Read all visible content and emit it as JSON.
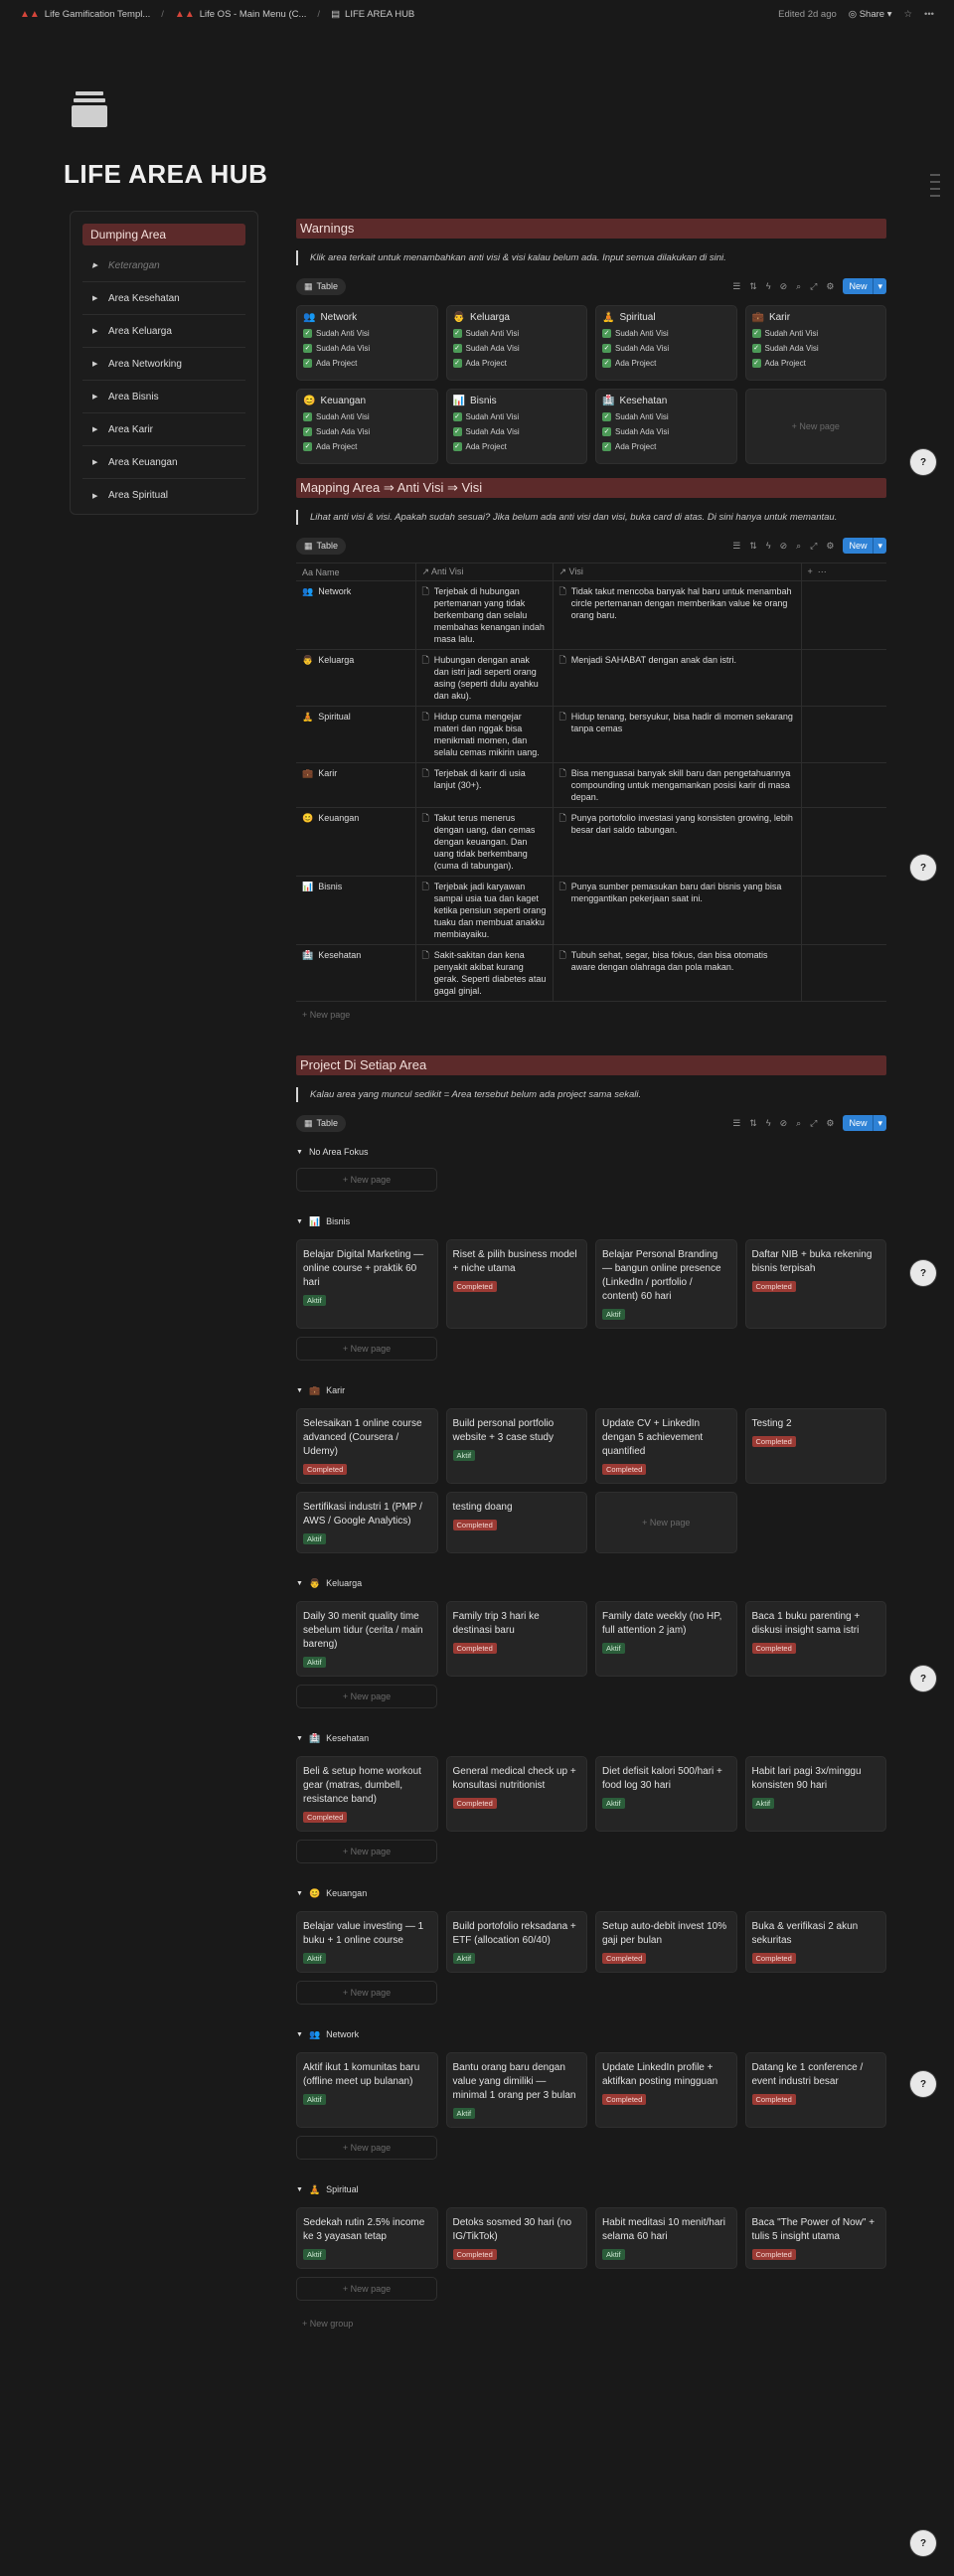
{
  "topbar": {
    "crumbs": [
      "Life Gamification Templ...",
      "Life OS - Main Menu (C...",
      "LIFE AREA HUB"
    ],
    "edited": "Edited 2d ago",
    "share": "Share"
  },
  "page": {
    "title": "LIFE AREA HUB"
  },
  "sidebar": {
    "title": "Dumping Area",
    "items": [
      "Keterangan",
      "Area Kesehatan",
      "Area Keluarga",
      "Area Networking",
      "Area Bisnis",
      "Area Karir",
      "Area Keuangan",
      "Area Spiritual"
    ]
  },
  "warnings": {
    "heading": "Warnings",
    "note": "Klik area terkait untuk menambahkan anti visi & visi kalau belum ada. Input semua dilakukan di sini.",
    "view": "Table",
    "new": "New",
    "cards": [
      {
        "icon": "👥",
        "title": "Network",
        "c1": "Sudah Anti Visi",
        "c2": "Sudah Ada Visi",
        "c3": "Ada Project"
      },
      {
        "icon": "👨",
        "title": "Keluarga",
        "c1": "Sudah Anti Visi",
        "c2": "Sudah Ada Visi",
        "c3": "Ada Project"
      },
      {
        "icon": "🧘",
        "title": "Spiritual",
        "c1": "Sudah Anti Visi",
        "c2": "Sudah Ada Visi",
        "c3": "Ada Project"
      },
      {
        "icon": "💼",
        "title": "Karir",
        "c1": "Sudah Anti Visi",
        "c2": "Sudah Ada Visi",
        "c3": "Ada Project"
      },
      {
        "icon": "😊",
        "title": "Keuangan",
        "c1": "Sudah Anti Visi",
        "c2": "Sudah Ada Visi",
        "c3": "Ada Project"
      },
      {
        "icon": "📊",
        "title": "Bisnis",
        "c1": "Sudah Anti Visi",
        "c2": "Sudah Ada Visi",
        "c3": "Ada Project"
      },
      {
        "icon": "🏥",
        "title": "Kesehatan",
        "c1": "Sudah Anti Visi",
        "c2": "Sudah Ada Visi",
        "c3": "Ada Project"
      }
    ],
    "newpage": "+ New page"
  },
  "mapping": {
    "heading": "Mapping Area ⇒ Anti Visi ⇒ Visi",
    "note": "Lihat anti visi & visi. Apakah sudah sesuai? Jika belum ada anti visi dan visi, buka card di atas. Di sini hanya untuk memantau.",
    "view": "Table",
    "new": "New",
    "cols": [
      "Name",
      "Anti Visi",
      "Visi"
    ],
    "rows": [
      {
        "icon": "👥",
        "name": "Network",
        "anti": "Terjebak di hubungan pertemanan yang tidak berkembang dan selalu membahas kenangan indah masa lalu.",
        "visi": "Tidak takut mencoba banyak hal baru untuk menambah circle pertemanan dengan memberikan value ke orang orang baru."
      },
      {
        "icon": "👨",
        "name": "Keluarga",
        "anti": "Hubungan dengan anak dan istri jadi seperti orang asing (seperti dulu ayahku dan aku).",
        "visi": "Menjadi SAHABAT dengan anak dan istri."
      },
      {
        "icon": "🧘",
        "name": "Spiritual",
        "anti": "Hidup cuma mengejar materi dan nggak bisa menikmati momen, dan selalu cemas mikirin uang.",
        "visi": "Hidup tenang, bersyukur, bisa hadir di momen sekarang tanpa cemas"
      },
      {
        "icon": "💼",
        "name": "Karir",
        "anti": "Terjebak di karir di usia lanjut (30+).",
        "visi": "Bisa menguasai banyak skill baru dan pengetahuannya compounding untuk mengamankan posisi karir di masa depan."
      },
      {
        "icon": "😊",
        "name": "Keuangan",
        "anti": "Takut terus menerus dengan uang, dan cemas dengan keuangan. Dan uang tidak berkembang (cuma di tabungan).",
        "visi": "Punya portofolio investasi yang konsisten growing, lebih besar dari saldo tabungan."
      },
      {
        "icon": "📊",
        "name": "Bisnis",
        "anti": "Terjebak jadi karyawan sampai usia tua dan kaget ketika pensiun seperti orang tuaku dan membuat anakku membiayaiku.",
        "visi": "Punya sumber pemasukan baru dari bisnis yang bisa menggantikan pekerjaan saat ini."
      },
      {
        "icon": "🏥",
        "name": "Kesehatan",
        "anti": "Sakit-sakitan dan kena penyakit akibat kurang gerak. Seperti diabetes atau gagal ginjal.",
        "visi": "Tubuh sehat, segar, bisa fokus, dan bisa otomatis aware dengan olahraga dan pola makan."
      }
    ],
    "newpage": "+ New page"
  },
  "projects": {
    "heading": "Project Di Setiap Area",
    "note": "Kalau area yang muncul sedikit = Area tersebut belum ada project sama sekali.",
    "view": "Table",
    "new": "New",
    "newpage": "+ New page",
    "newgroup": "+ New group",
    "groups": [
      {
        "icon": "",
        "name": "No Area Fokus",
        "cards": []
      },
      {
        "icon": "📊",
        "name": "Bisnis",
        "cards": [
          {
            "t": "Belajar Digital Marketing — online course + praktik 60 hari",
            "s": "Aktif"
          },
          {
            "t": "Riset & pilih business model + niche utama",
            "s": "Completed"
          },
          {
            "t": "Belajar Personal Branding — bangun online presence (LinkedIn / portfolio / content) 60 hari",
            "s": "Aktif"
          },
          {
            "t": "Daftar NIB + buka rekening bisnis terpisah",
            "s": "Completed"
          }
        ]
      },
      {
        "icon": "💼",
        "name": "Karir",
        "cards": [
          {
            "t": "Selesaikan 1 online course advanced (Coursera / Udemy)",
            "s": "Completed"
          },
          {
            "t": "Build personal portfolio website + 3 case study",
            "s": "Aktif"
          },
          {
            "t": "Update CV + LinkedIn dengan 5 achievement quantified",
            "s": "Completed"
          },
          {
            "t": "Testing 2",
            "s": "Completed"
          },
          {
            "t": "Sertifikasi industri 1 (PMP / AWS / Google Analytics)",
            "s": "Aktif"
          },
          {
            "t": "testing doang",
            "s": "Completed"
          }
        ]
      },
      {
        "icon": "👨",
        "name": "Keluarga",
        "cards": [
          {
            "t": "Daily 30 menit quality time sebelum tidur (cerita / main bareng)",
            "s": "Aktif"
          },
          {
            "t": "Family trip 3 hari ke destinasi baru",
            "s": "Completed"
          },
          {
            "t": "Family date weekly (no HP, full attention 2 jam)",
            "s": "Aktif"
          },
          {
            "t": "Baca 1 buku parenting + diskusi insight sama istri",
            "s": "Completed"
          }
        ]
      },
      {
        "icon": "🏥",
        "name": "Kesehatan",
        "cards": [
          {
            "t": "Beli & setup home workout gear (matras, dumbell, resistance band)",
            "s": "Completed"
          },
          {
            "t": "General medical check up + konsultasi nutritionist",
            "s": "Completed"
          },
          {
            "t": "Diet defisit kalori 500/hari + food log 30 hari",
            "s": "Aktif"
          },
          {
            "t": "Habit lari pagi 3x/minggu konsisten 90 hari",
            "s": "Aktif"
          }
        ]
      },
      {
        "icon": "😊",
        "name": "Keuangan",
        "cards": [
          {
            "t": "Belajar value investing — 1 buku + 1 online course",
            "s": "Aktif"
          },
          {
            "t": "Build portofolio reksadana + ETF (allocation 60/40)",
            "s": "Aktif"
          },
          {
            "t": "Setup auto-debit invest 10% gaji per bulan",
            "s": "Completed"
          },
          {
            "t": "Buka & verifikasi 2 akun sekuritas",
            "s": "Completed"
          }
        ]
      },
      {
        "icon": "👥",
        "name": "Network",
        "cards": [
          {
            "t": "Aktif ikut 1 komunitas baru (offline meet up bulanan)",
            "s": "Aktif"
          },
          {
            "t": "Bantu orang baru dengan value yang dimiliki — minimal 1 orang per 3 bulan",
            "s": "Aktif"
          },
          {
            "t": "Update LinkedIn profile + aktifkan posting mingguan",
            "s": "Completed"
          },
          {
            "t": "Datang ke 1 conference / event industri besar",
            "s": "Completed"
          }
        ]
      },
      {
        "icon": "🧘",
        "name": "Spiritual",
        "cards": [
          {
            "t": "Sedekah rutin 2.5% income ke 3 yayasan tetap",
            "s": "Aktif"
          },
          {
            "t": "Detoks sosmed 30 hari (no IG/TikTok)",
            "s": "Completed"
          },
          {
            "t": "Habit meditasi 10 menit/hari selama 60 hari",
            "s": "Aktif"
          },
          {
            "t": "Baca \"The Power of Now\" + tulis 5 insight utama",
            "s": "Completed"
          }
        ]
      }
    ]
  },
  "colors": {
    "accent": "#2e82d6",
    "heading_bg": "#5c2a2a",
    "aktif": "#2b5d3a",
    "completed": "#9b3a34"
  }
}
